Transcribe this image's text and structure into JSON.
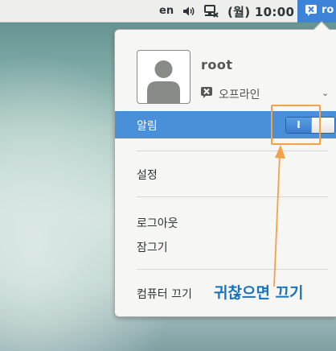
{
  "top_bar": {
    "language": "en",
    "volume_icon": "speaker-icon",
    "network_icon": "network-offline-icon",
    "clock": "(월) 10:00",
    "user_icon": "user-offline-icon",
    "user_label": "ro",
    "user_accent": "#3d83d8"
  },
  "user_menu": {
    "username": "root",
    "avatar_icon": "person-icon",
    "status_icon": "offline-icon",
    "status": "오프라인",
    "notifications_label": "알림",
    "notifications_toggle_text": "I",
    "notifications_on": true,
    "highlight_color": "#4a90d9",
    "items": {
      "settings": "설정",
      "logout": "로그아웃",
      "lock": "잠그기",
      "power_off": "컴퓨터 끄기"
    }
  },
  "annotation": {
    "text": "귀찮으면 끄기",
    "color": "#f5a145"
  }
}
